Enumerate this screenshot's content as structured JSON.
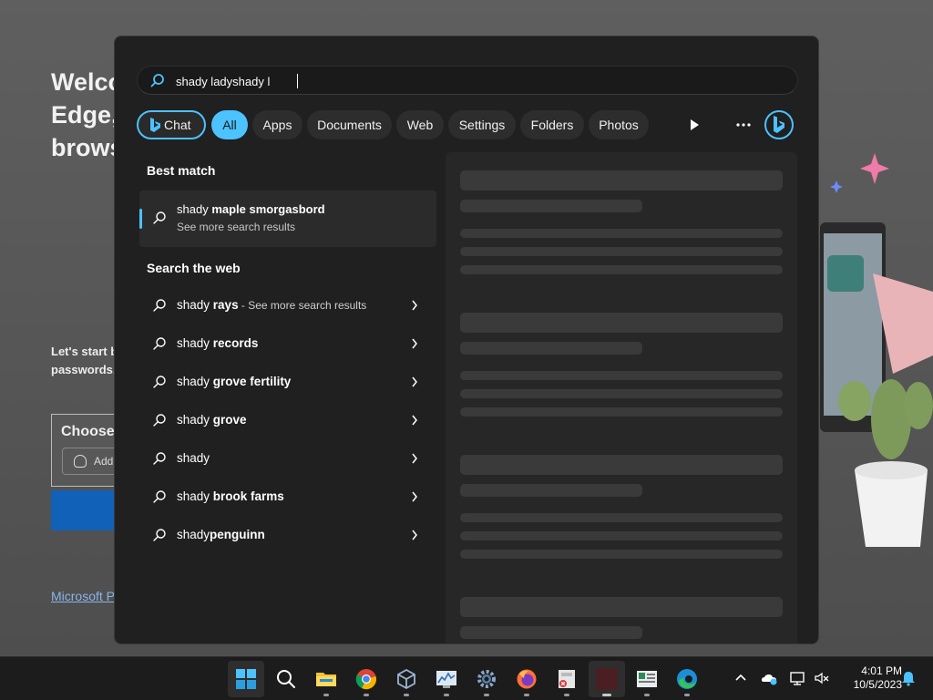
{
  "background": {
    "title_lines": [
      "Welco",
      "Edge,",
      "brows"
    ],
    "subtitle_lines": [
      "Let's start b",
      "passwords,"
    ],
    "choose_label": "Choose",
    "add_label": "Add",
    "link_text": "Microsoft P"
  },
  "search": {
    "query": "shady ladyshady l"
  },
  "filters": {
    "chat": "Chat",
    "all": "All",
    "apps": "Apps",
    "documents": "Documents",
    "web": "Web",
    "settings": "Settings",
    "folders": "Folders",
    "photos": "Photos"
  },
  "best_match": {
    "heading": "Best match",
    "prefix": "shady",
    "bold": "maple smorgasbord",
    "sub": "See more search results"
  },
  "web_results": {
    "heading": "Search the web",
    "items": [
      {
        "prefix": "shady",
        "bold": "rays",
        "note": " - See more search results"
      },
      {
        "prefix": "shady",
        "bold": "records",
        "note": ""
      },
      {
        "prefix": "shady",
        "bold": "grove fertility",
        "note": ""
      },
      {
        "prefix": "shady",
        "bold": "grove",
        "note": ""
      },
      {
        "prefix": "shady",
        "bold": "",
        "note": ""
      },
      {
        "prefix": "shady",
        "bold": "brook farms",
        "note": ""
      },
      {
        "prefix": "shady",
        "bold": "penguinn",
        "note": ""
      }
    ]
  },
  "taskbar": {
    "apps": [
      "start-icon",
      "search-icon",
      "file-explorer-icon",
      "chrome-icon",
      "virtualbox-icon",
      "resource-monitor-icon",
      "settings-icon",
      "firefox-icon",
      "remote-app-icon",
      "blank-app-icon",
      "control-panel-icon",
      "edge-icon"
    ],
    "time": "4:01 PM",
    "date": "10/5/2023"
  },
  "colors": {
    "accent": "#4cc2ff",
    "flyout_bg": "#202020",
    "taskbar_bg": "#1c1c1c"
  }
}
